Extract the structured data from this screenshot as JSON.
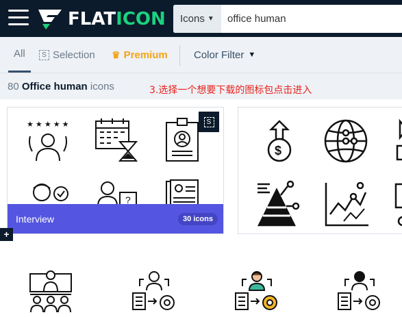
{
  "header": {
    "logo_flat": "FLAT",
    "logo_icon": "ICON",
    "search_type": "Icons",
    "search_value": "office human"
  },
  "tabs": {
    "all": "All",
    "selection": "Selection",
    "premium": "Premium",
    "color_filter": "Color Filter"
  },
  "results": {
    "count": "80",
    "query": "Office human",
    "suffix": "icons"
  },
  "annotation": "3.选择一个想要下载的图标包点击进入",
  "pack": {
    "title": "Interview",
    "count": "30 icons"
  },
  "icons": {
    "pack1": [
      "star-rating-person-icon",
      "calendar-hourglass-icon",
      "id-badge-icon",
      "checkmark-person-icon",
      "question-person-icon",
      "resume-document-icon"
    ],
    "pack2": [
      "money-growth-icon",
      "globe-network-icon",
      "pyramid-chart-icon",
      "line-growth-chart-icon"
    ],
    "row3": [
      "meeting-presentation-icon",
      "person-process-gear-icon",
      "person-process-gear-color-icon",
      "person-process-gear-lines-icon"
    ]
  },
  "colors": {
    "header_bg": "#0b1b2b",
    "logo_green": "#1bd17f",
    "premium": "#f3a416",
    "pack_footer": "#5455e0",
    "annotation": "#e8241e"
  }
}
